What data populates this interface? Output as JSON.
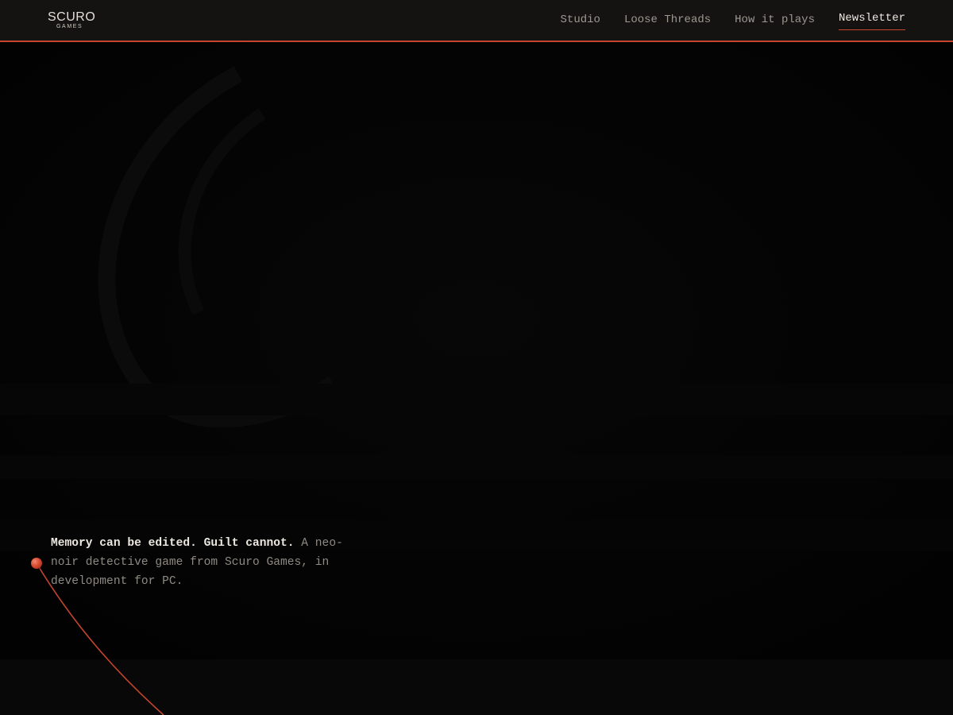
{
  "brand": {
    "wordmark": "SCURO",
    "sub": "GAMES"
  },
  "nav": {
    "items": [
      {
        "label": "Studio",
        "active": false
      },
      {
        "label": "Loose Threads",
        "active": false
      },
      {
        "label": "How it plays",
        "active": false
      },
      {
        "label": "Newsletter",
        "active": true
      }
    ]
  },
  "hero": {
    "tagline_strong": "Memory can be edited. Guilt cannot.",
    "tagline_rest": " A neo-noir detective game from Scuro Games, in development for PC."
  },
  "colors": {
    "accent": "#c7442e",
    "background": "#040404",
    "topbar": "#141312",
    "text": "#ece8e0",
    "muted": "#8f8a82"
  },
  "icons": {
    "pin": "red-pushpin-icon"
  }
}
